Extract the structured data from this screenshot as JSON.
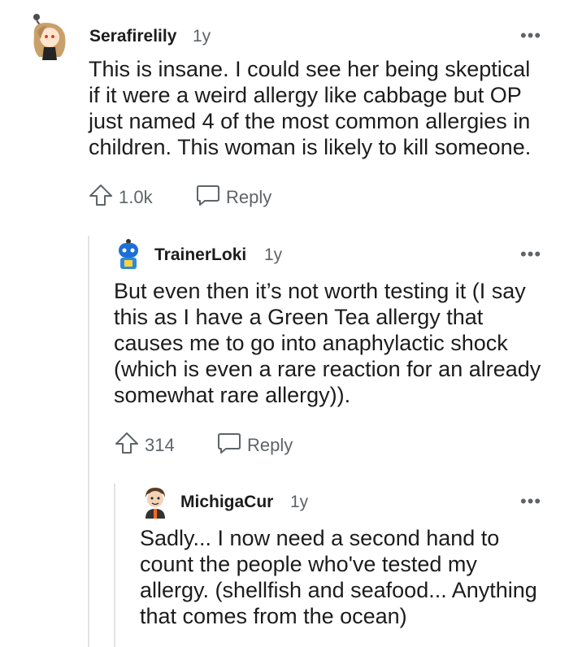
{
  "comments": [
    {
      "username": "Serafirelily",
      "age": "1y",
      "more": "•••",
      "lines": [
        "This is insane. I could see her being skeptical",
        "if it were a weird allergy like cabbage but OP",
        "just named 4 of the most common allergies in",
        "children. This woman is likely to kill someone."
      ],
      "upvotes": "1.0k",
      "reply": "Reply"
    },
    {
      "username": "TrainerLoki",
      "age": "1y",
      "more": "•••",
      "lines": [
        "But even then it’s not worth testing it (I say",
        "this as I have a Green Tea allergy that",
        "causes me to go into anaphylactic shock",
        "(which is even a rare reaction for an already",
        "somewhat rare allergy))."
      ],
      "upvotes": "314",
      "reply": "Reply"
    },
    {
      "username": "MichigaCur",
      "age": "1y",
      "more": "•••",
      "lines": [
        "Sadly... I now need a second hand to",
        "count the people who've tested my",
        "allergy. (shellfish and seafood... Anything",
        "that comes from the ocean)"
      ]
    }
  ],
  "icons": {
    "upvote": "upvote-arrow-icon",
    "reply": "speech-bubble-icon",
    "more": "more-options-icon"
  }
}
